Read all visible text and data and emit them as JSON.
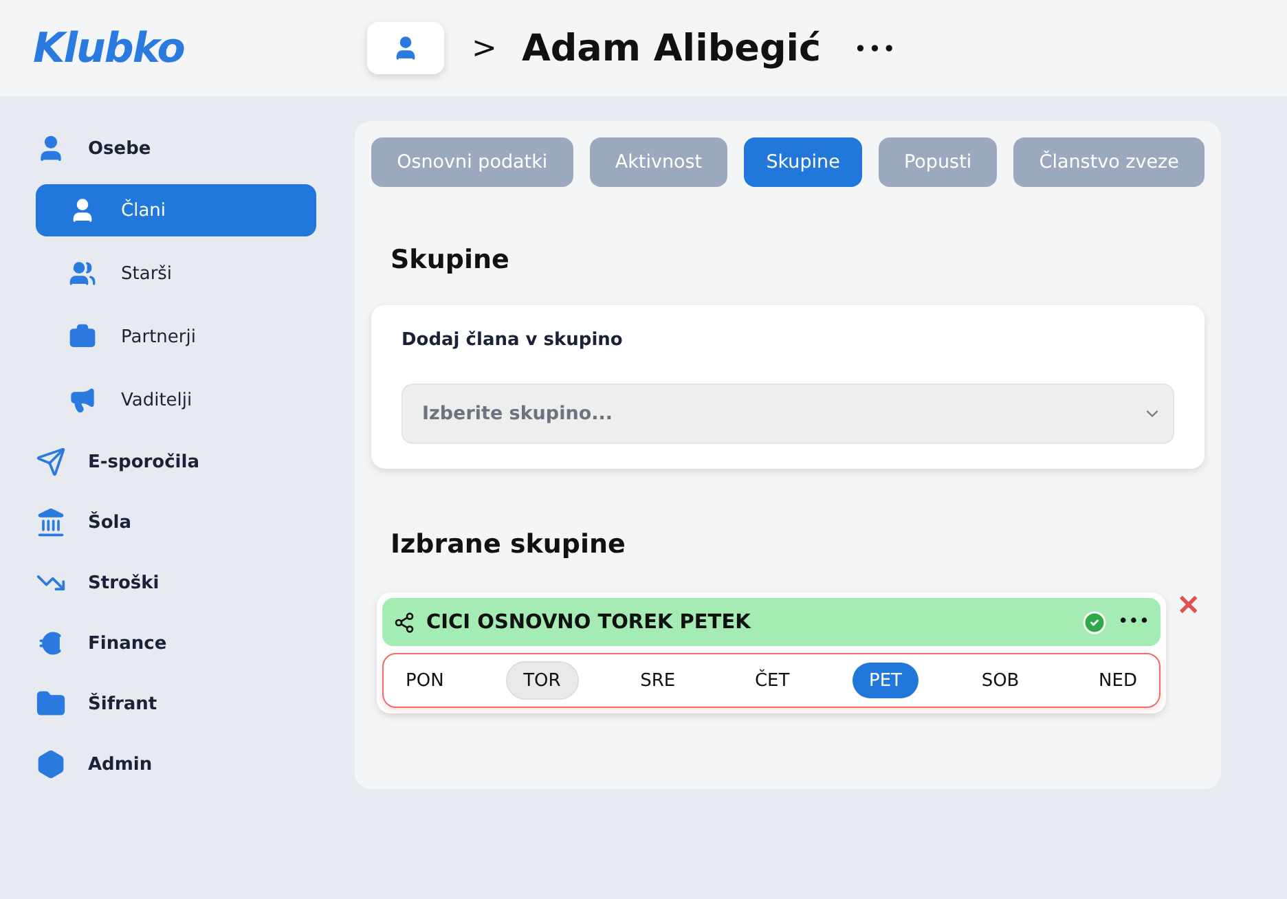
{
  "logo": "Klubko",
  "breadcrumb": {
    "separator": ">",
    "title": "Adam Alibegić",
    "more": "•••"
  },
  "sidebar": {
    "items": [
      {
        "label": "Osebe",
        "selected": false,
        "children": [
          {
            "label": "Člani",
            "selected": true
          },
          {
            "label": "Starši",
            "selected": false
          },
          {
            "label": "Partnerji",
            "selected": false
          },
          {
            "label": "Vaditelji",
            "selected": false
          }
        ]
      },
      {
        "label": "E-sporočila",
        "selected": false
      },
      {
        "label": "Šola",
        "selected": false
      },
      {
        "label": "Stroški",
        "selected": false
      },
      {
        "label": "Finance",
        "selected": false
      },
      {
        "label": "Šifrant",
        "selected": false
      },
      {
        "label": "Admin",
        "selected": false
      }
    ]
  },
  "tabs": [
    {
      "label": "Osnovni podatki",
      "selected": false
    },
    {
      "label": "Aktivnost",
      "selected": false
    },
    {
      "label": "Skupine",
      "selected": true
    },
    {
      "label": "Popusti",
      "selected": false
    },
    {
      "label": "Članstvo zveze",
      "selected": false
    }
  ],
  "section_title": "Skupine",
  "add_card": {
    "label": "Dodaj člana v skupino",
    "select": {
      "placeholder": "Izberite skupino..."
    }
  },
  "selected_title": "Izbrane skupine",
  "groups": [
    {
      "name": "CICI OSNOVNO TOREK PETEK",
      "confirmed": true,
      "more": "•••",
      "remove": "✕",
      "days": [
        {
          "label": "PON",
          "selected": false,
          "highlighted": false
        },
        {
          "label": "TOR",
          "selected": false,
          "highlighted": true
        },
        {
          "label": "SRE",
          "selected": false,
          "highlighted": false
        },
        {
          "label": "ČET",
          "selected": false,
          "highlighted": false
        },
        {
          "label": "PET",
          "selected": true,
          "highlighted": false
        },
        {
          "label": "SOB",
          "selected": false,
          "highlighted": false
        },
        {
          "label": "NED",
          "selected": false,
          "highlighted": false
        }
      ]
    }
  ]
}
